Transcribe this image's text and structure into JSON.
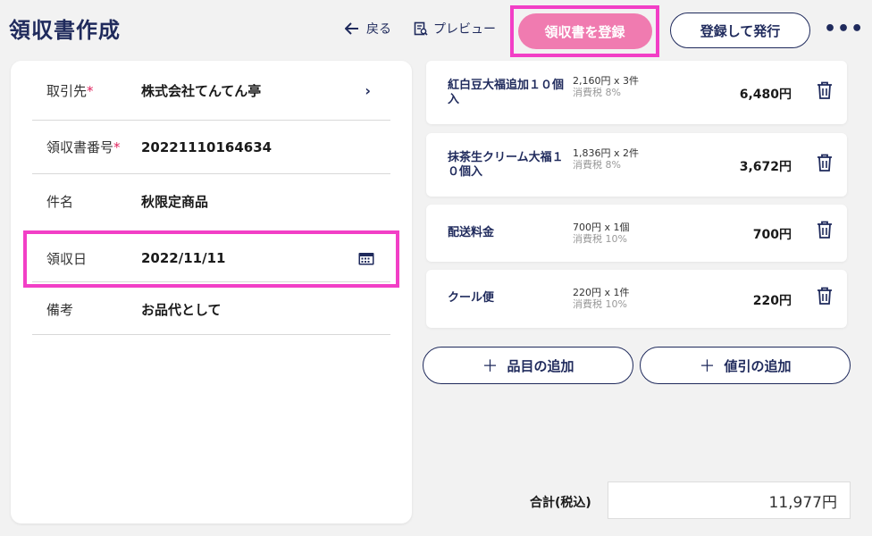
{
  "page": {
    "title": "領収書作成"
  },
  "toolbar": {
    "back_label": "戻る",
    "preview_label": "プレビュー",
    "register_label": "領収書を登録",
    "issue_label": "登録して発行",
    "more_label": "•••"
  },
  "form": {
    "client": {
      "label": "取引先",
      "required_mark": "*",
      "value": "株式会社てんてん亭"
    },
    "receipt_no": {
      "label": "領収書番号",
      "required_mark": "*",
      "value": "20221110164634"
    },
    "subject": {
      "label": "件名",
      "value": "秋限定商品"
    },
    "receipt_date": {
      "label": "領収日",
      "value": "2022/11/11"
    },
    "note": {
      "label": "備考",
      "value": "お品代として"
    }
  },
  "items": [
    {
      "name": "紅白豆大福追加１０個入",
      "qty": "2,160円 x 3件",
      "tax": "消費税 8%",
      "amount": "6,480円"
    },
    {
      "name": "抹茶生クリーム大福１０個入",
      "qty": "1,836円 x 2件",
      "tax": "消費税 8%",
      "amount": "3,672円"
    },
    {
      "name": "配送料金",
      "qty": "700円 x 1個",
      "tax": "消費税 10%",
      "amount": "700円"
    },
    {
      "name": "クール便",
      "qty": "220円 x 1件",
      "tax": "消費税 10%",
      "amount": "220円"
    }
  ],
  "actions": {
    "add_item_label": "品目の追加",
    "add_discount_label": "値引の追加",
    "plus": "＋"
  },
  "total": {
    "label": "合計(税込)",
    "value": "11,977円"
  },
  "colors": {
    "accent_navy": "#1f2a5c",
    "highlight_magenta": "#f23fc6",
    "register_pink": "#f07bb0"
  }
}
